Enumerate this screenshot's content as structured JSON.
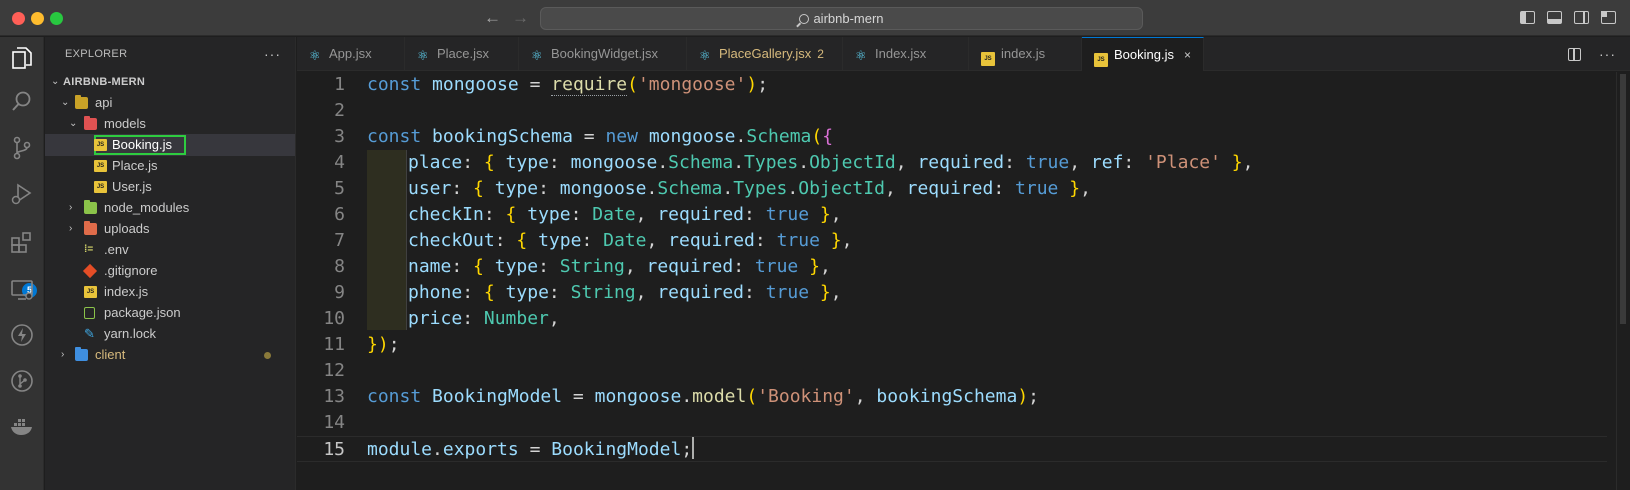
{
  "window": {
    "search_text": "airbnb-mern"
  },
  "activity": {
    "extensions_badge": "5"
  },
  "explorer": {
    "title": "EXPLORER",
    "more": "···",
    "root": "AIRBNB-MERN",
    "tree": [
      {
        "label": "api",
        "chev": "⌄",
        "color": "#cccccc"
      },
      {
        "label": "models",
        "chev": "⌄",
        "color": "#cccccc"
      },
      {
        "label": "Booking.js",
        "chev": "",
        "color": "#ffffff"
      },
      {
        "label": "Place.js",
        "chev": "",
        "color": "#cccccc"
      },
      {
        "label": "User.js",
        "chev": "",
        "color": "#cccccc"
      },
      {
        "label": "node_modules",
        "chev": "›",
        "color": "#cccccc"
      },
      {
        "label": "uploads",
        "chev": "›",
        "color": "#cccccc"
      },
      {
        "label": ".env",
        "chev": "",
        "color": "#cccccc"
      },
      {
        "label": ".gitignore",
        "chev": "",
        "color": "#cccccc"
      },
      {
        "label": "index.js",
        "chev": "",
        "color": "#cccccc"
      },
      {
        "label": "package.json",
        "chev": "",
        "color": "#cccccc"
      },
      {
        "label": "yarn.lock",
        "chev": "",
        "color": "#cccccc"
      },
      {
        "label": "client",
        "chev": "›",
        "color": "#d7ba7d"
      }
    ]
  },
  "tabs": [
    {
      "label": "App.jsx"
    },
    {
      "label": "Place.jsx"
    },
    {
      "label": "BookingWidget.jsx"
    },
    {
      "label": "PlaceGallery.jsx",
      "count": "2"
    },
    {
      "label": "Index.jsx"
    },
    {
      "label": "index.js"
    },
    {
      "label": "Booking.js",
      "close": "×"
    }
  ],
  "editor": {
    "line_numbers": [
      "1",
      "2",
      "3",
      "4",
      "5",
      "6",
      "7",
      "8",
      "9",
      "10",
      "11",
      "12",
      "13",
      "14",
      "15"
    ],
    "current_line": "15",
    "lines": [
      "const mongoose = require('mongoose');",
      "",
      "const bookingSchema = new mongoose.Schema({",
      "  place: { type: mongoose.Schema.Types.ObjectId, required: true, ref: 'Place' },",
      "  user: { type: mongoose.Schema.Types.ObjectId, required: true },",
      "  checkIn: { type: Date, required: true },",
      "  checkOut: { type: Date, required: true },",
      "  name: { type: String, required: true },",
      "  phone: { type: String, required: true },",
      "  price: Number,",
      "});",
      "",
      "const BookingModel = mongoose.model('Booking', bookingSchema);",
      "",
      "module.exports = BookingModel;"
    ]
  }
}
